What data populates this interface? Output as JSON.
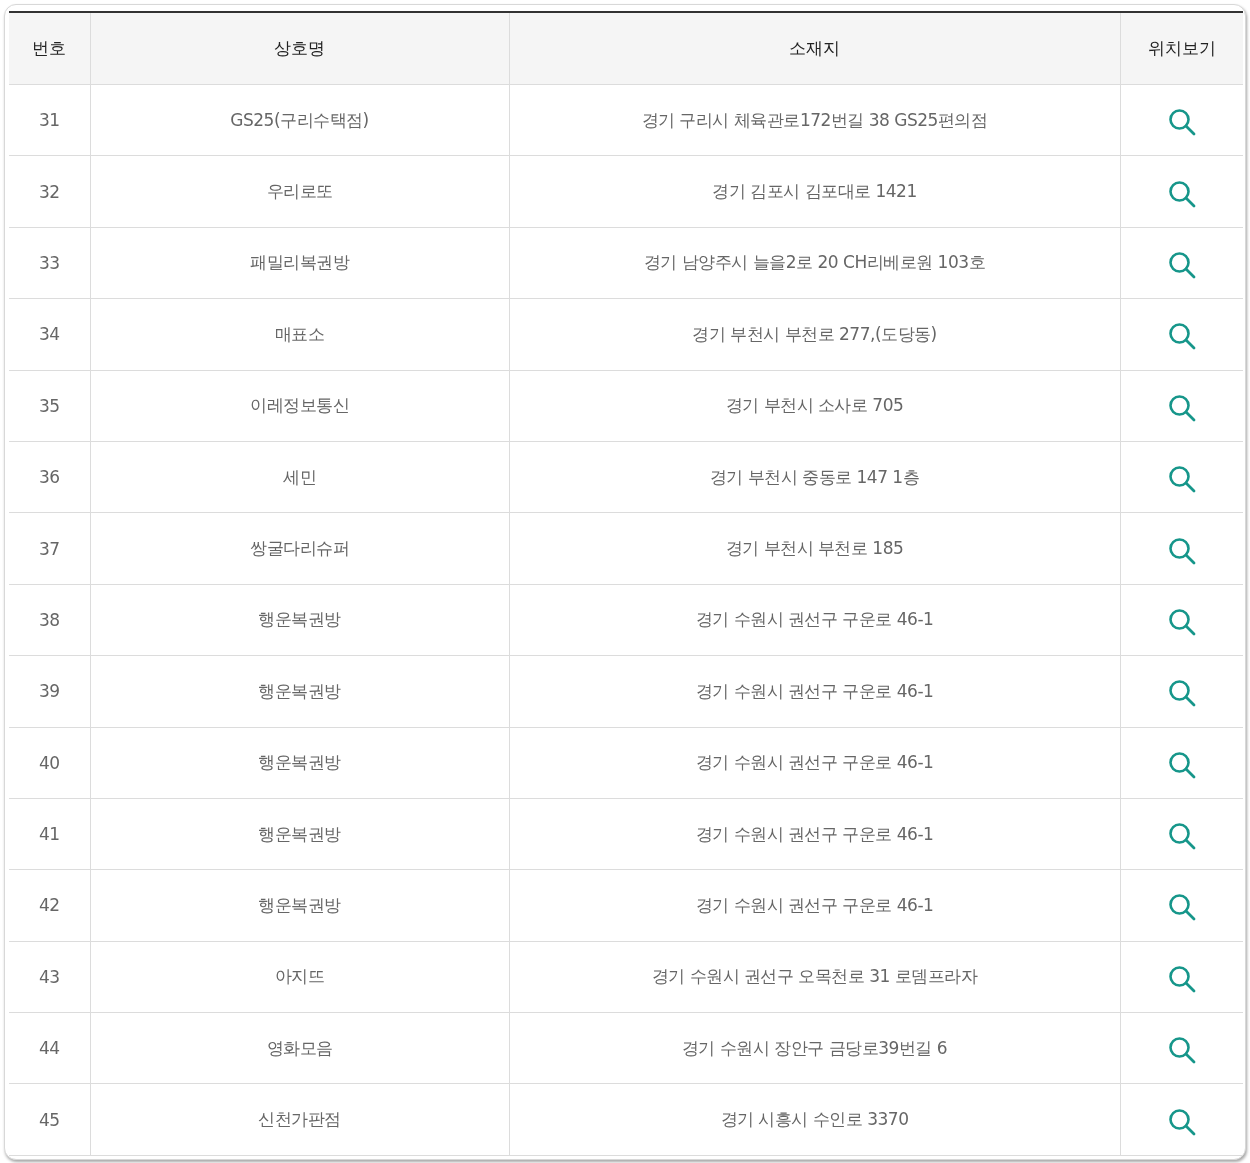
{
  "table": {
    "columns": [
      "번호",
      "상호명",
      "소재지",
      "위치보기"
    ],
    "rows": [
      {
        "number": "31",
        "name": "GS25(구리수택점)",
        "address": "경기 구리시 체육관로172번길 38 GS25편의점"
      },
      {
        "number": "32",
        "name": "우리로또",
        "address": "경기 김포시 김포대로 1421"
      },
      {
        "number": "33",
        "name": "패밀리복권방",
        "address": "경기 남양주시 늘을2로 20 CH리베로원 103호"
      },
      {
        "number": "34",
        "name": "매표소",
        "address": "경기 부천시 부천로 277,(도당동)"
      },
      {
        "number": "35",
        "name": "이레정보통신",
        "address": "경기 부천시 소사로 705"
      },
      {
        "number": "36",
        "name": "세민",
        "address": "경기 부천시 중동로 147 1층"
      },
      {
        "number": "37",
        "name": "쌍굴다리슈퍼",
        "address": "경기 부천시 부천로 185"
      },
      {
        "number": "38",
        "name": "행운복권방",
        "address": "경기 수원시 권선구 구운로 46-1"
      },
      {
        "number": "39",
        "name": "행운복권방",
        "address": "경기 수원시 권선구 구운로 46-1"
      },
      {
        "number": "40",
        "name": "행운복권방",
        "address": "경기 수원시 권선구 구운로 46-1"
      },
      {
        "number": "41",
        "name": "행운복권방",
        "address": "경기 수원시 권선구 구운로 46-1"
      },
      {
        "number": "42",
        "name": "행운복권방",
        "address": "경기 수원시 권선구 구운로 46-1"
      },
      {
        "number": "43",
        "name": "아지뜨",
        "address": "경기 수원시 권선구 오목천로 31 로뎀프라자"
      },
      {
        "number": "44",
        "name": "영화모음",
        "address": "경기 수원시 장안구 금당로39번길 6"
      },
      {
        "number": "45",
        "name": "신천가판점",
        "address": "경기 시흥시 수인로 3370"
      }
    ]
  }
}
